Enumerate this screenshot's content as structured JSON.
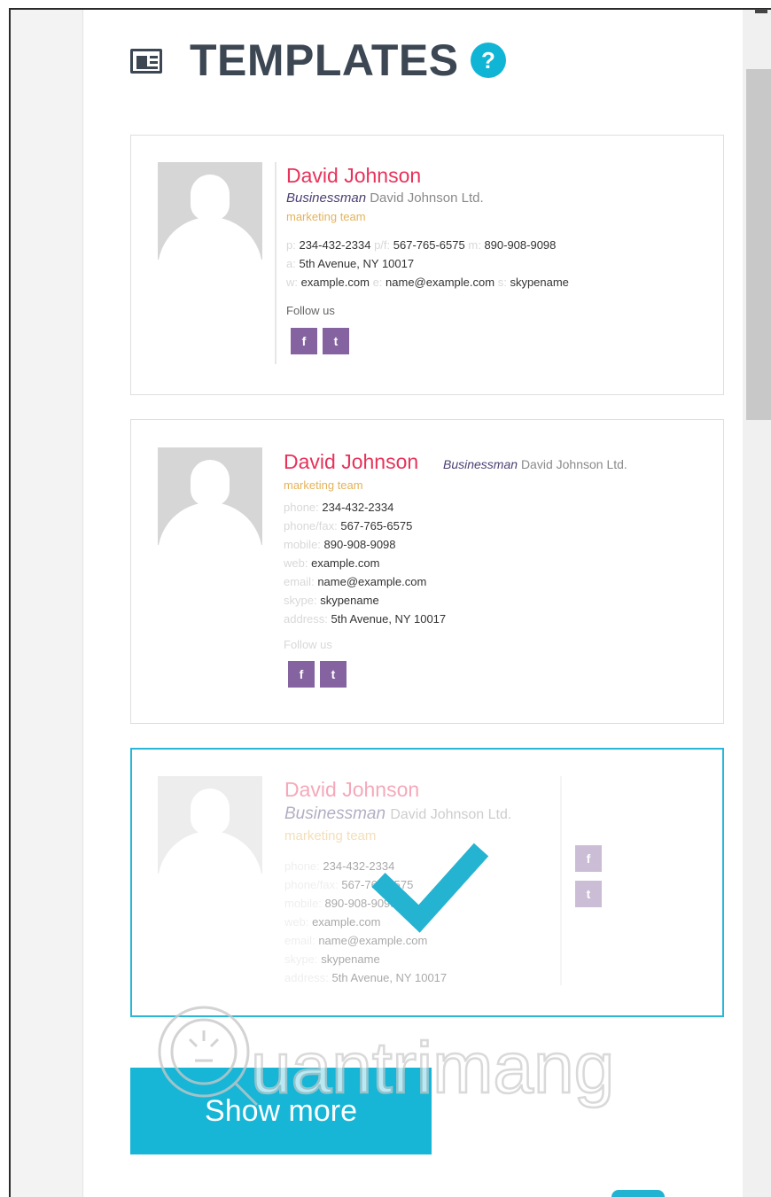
{
  "header": {
    "title": "TEMPLATES",
    "help": "?"
  },
  "contact": {
    "name": "David Johnson",
    "role": "Businessman",
    "company": "David Johnson Ltd.",
    "team": "marketing team",
    "phone": "234-432-2334",
    "fax": "567-765-6575",
    "mobile": "890-908-9098",
    "address": "5th Avenue, NY 10017",
    "web": "example.com",
    "email": "name@example.com",
    "skype": "skypename",
    "follow": "Follow us"
  },
  "labels_short": {
    "p": "p:",
    "pf": "p/f:",
    "m": "m:",
    "a": "a:",
    "w": "w:",
    "e": "e:",
    "s": "s:"
  },
  "labels_long": {
    "phone": "phone:",
    "phonefax": "phone/fax:",
    "mobile": "mobile:",
    "web": "web:",
    "email": "email:",
    "skype": "skype:",
    "address": "address:"
  },
  "social": {
    "facebook": "f",
    "twitter": "t"
  },
  "show_more": "Show more",
  "watermark": "Quantrimang",
  "colors": {
    "accent": "#17b6d6",
    "name": "#e8325a",
    "social": "#8463a0",
    "team": "#e3b35a"
  }
}
